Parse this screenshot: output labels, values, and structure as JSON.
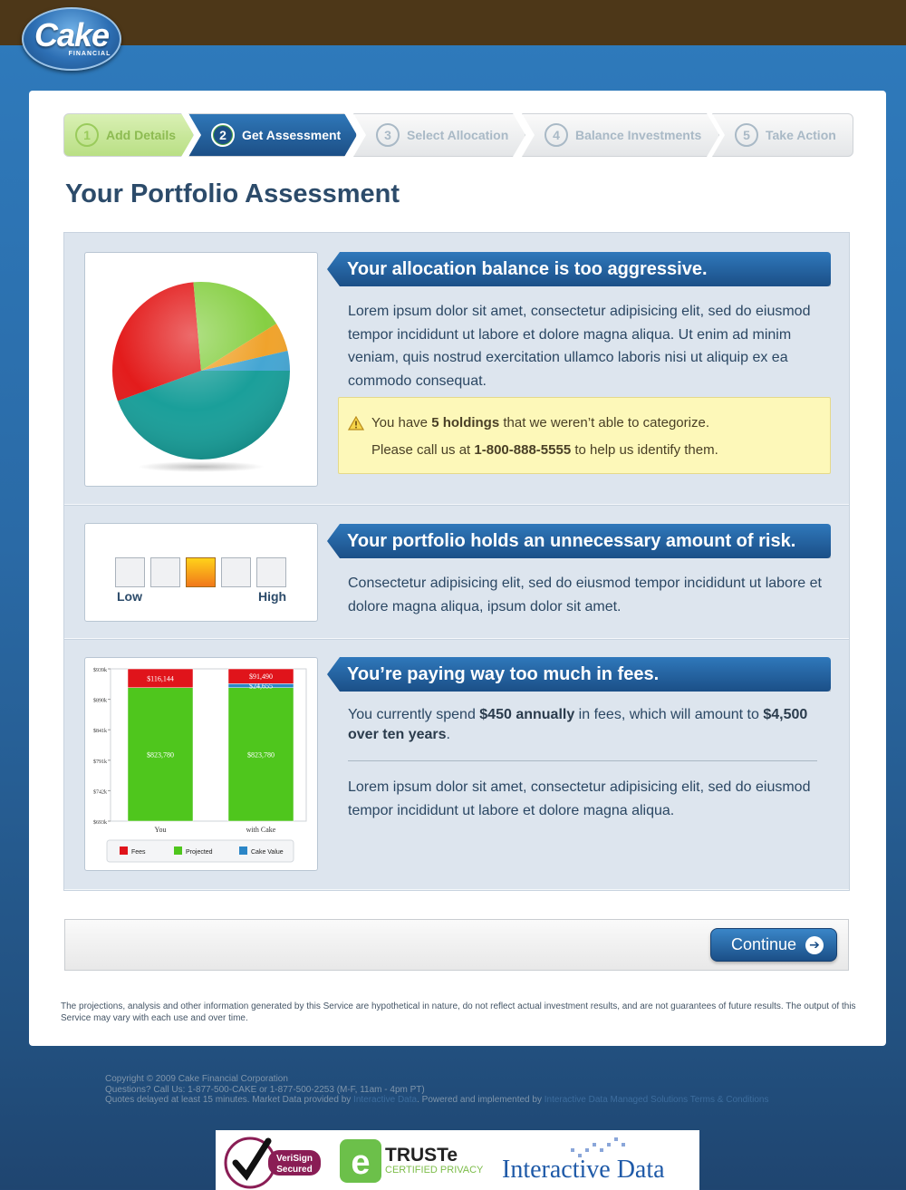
{
  "brand": {
    "name": "Cake",
    "sub": "FINANCIAL"
  },
  "steps": [
    {
      "num": "1",
      "label": "Add Details",
      "state": "done"
    },
    {
      "num": "2",
      "label": "Get Assessment",
      "state": "active"
    },
    {
      "num": "3",
      "label": "Select Allocation",
      "state": "todo"
    },
    {
      "num": "4",
      "label": "Balance Investments",
      "state": "todo"
    },
    {
      "num": "5",
      "label": "Take Action",
      "state": "todo"
    }
  ],
  "page_title": "Your Portfolio Assessment",
  "allocation": {
    "heading": "Your allocation balance is too aggressive.",
    "text": "Lorem ipsum dolor sit amet, consectetur adipisicing elit, sed do eiusmod tempor incididunt ut labore et dolore magna aliqua. Ut enim ad minim veniam, quis nostrud exercitation ullamco laboris nisi ut aliquip ex ea commodo consequat.",
    "pie_colors": [
      "#1a9f9a",
      "#e31c1c",
      "#86cf43",
      "#f0a32c",
      "#45a6d3"
    ],
    "warning": {
      "l1_pre": "You have ",
      "l1_bold": "5 holdings",
      "l1_post": " that we weren’t able to categorize.",
      "l2_pre": "Please call us at ",
      "l2_bold": "1-800-888-5555",
      "l2_post": " to help us identify them."
    }
  },
  "risk": {
    "heading": "Your portfolio holds an unnecessary amount of risk.",
    "text": "Consectetur adipisicing elit, sed do eiusmod tempor incididunt ut labore et dolore magna aliqua, ipsum dolor sit amet.",
    "level": 3,
    "levels": 5,
    "low_label": "Low",
    "high_label": "High"
  },
  "fees": {
    "heading": "You’re paying way too much in fees.",
    "p1_pre": "You currently spend ",
    "p1_bold1": "$450 annually",
    "p1_mid": " in fees, which will amount to ",
    "p1_bold2": "$4,500 over ten years",
    "p1_post": ".",
    "p2": "Lorem ipsum dolor sit amet, consectetur adipisicing elit, sed do eiusmod tempor incididunt ut labore et dolore magna aliqua."
  },
  "chart_data": {
    "type": "bar",
    "stacked": true,
    "categories": [
      "You",
      "with Cake"
    ],
    "y_ticks": [
      "$939k",
      "$890k",
      "$841k",
      "$791k",
      "$742k",
      "$693k"
    ],
    "ylim": [
      693,
      939
    ],
    "series": [
      {
        "name": "Projected",
        "color": "#4fc61d",
        "values": [
          823780,
          823780
        ],
        "labels": [
          "$823,780",
          "$823,780"
        ]
      },
      {
        "name": "Cake Value",
        "color": "#2b86c7",
        "values": [
          0,
          24655
        ],
        "labels": [
          "",
          "$24,655"
        ]
      },
      {
        "name": "Fees",
        "color": "#e0141b",
        "values": [
          116144,
          91490
        ],
        "labels": [
          "$116,144",
          "$91,490"
        ]
      }
    ],
    "legend": [
      "Fees",
      "Projected",
      "Cake Value"
    ],
    "legend_colors": [
      "#e0141b",
      "#4fc61d",
      "#2b86c7"
    ]
  },
  "continue_label": "Continue",
  "disclaimer": "The projections, analysis and other information generated by this Service are hypothetical in nature, do not reflect actual investment results, and are not guarantees of future results. The output of this Service may vary with each use and over time.",
  "footer": {
    "copyright": "Copyright © 2009 Cake Financial Corporation",
    "questions": "Questions? Call Us: 1-877-500-CAKE or 1-877-500-2253 (M-F, 11am - 4pm PT)",
    "quotes_pre": "Quotes delayed at least 15 minutes. Market Data provided by ",
    "quotes_link1": "Interactive Data",
    "quotes_mid": ". Powered and implemented by ",
    "quotes_link2": "Interactive Data Managed Solutions",
    "quotes_link3": "Terms & Conditions"
  },
  "badges": {
    "verisign_1": "VeriSign",
    "verisign_2": "Secured",
    "truste_1": "TRUSTe",
    "truste_2": "CERTIFIED PRIVACY",
    "interactive": "Interactive Data"
  }
}
